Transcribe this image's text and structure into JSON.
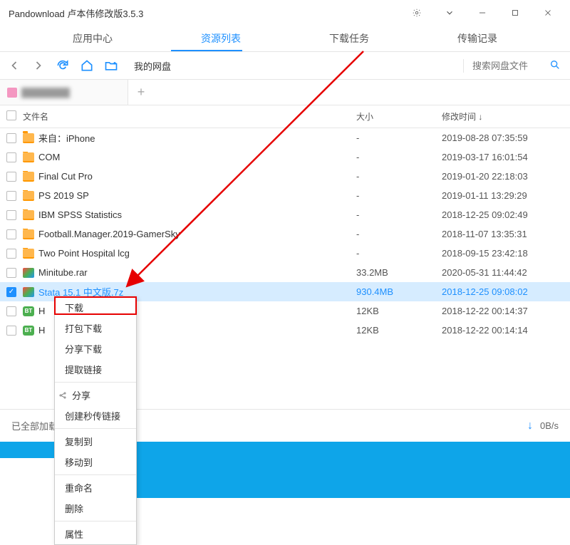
{
  "title": "Pandownload 卢本伟修改版3.5.3",
  "tabs": [
    "应用中心",
    "资源列表",
    "下载任务",
    "传输记录"
  ],
  "activeTab": 1,
  "path": "我的网盘",
  "searchPlaceholder": "搜索网盘文件",
  "columns": {
    "name": "文件名",
    "size": "大小",
    "time": "修改时间 ↓"
  },
  "files": [
    {
      "type": "folder",
      "name": "来自：iPhone",
      "size": "-",
      "time": "2019-08-28 07:35:59",
      "checked": false
    },
    {
      "type": "folder",
      "name": "COM",
      "size": "-",
      "time": "2019-03-17 16:01:54",
      "checked": false
    },
    {
      "type": "folder",
      "name": "Final Cut Pro",
      "size": "-",
      "time": "2019-01-20 22:18:03",
      "checked": false
    },
    {
      "type": "folder",
      "name": "PS 2019 SP",
      "size": "-",
      "time": "2019-01-11 13:29:29",
      "checked": false
    },
    {
      "type": "folder",
      "name": "IBM SPSS Statistics",
      "size": "-",
      "time": "2018-12-25 09:02:49",
      "checked": false
    },
    {
      "type": "folder",
      "name": "Football.Manager.2019-GamerSky",
      "size": "-",
      "time": "2018-11-07 13:35:31",
      "checked": false
    },
    {
      "type": "folder",
      "name": "Two Point Hospital lcg",
      "size": "-",
      "time": "2018-09-15 23:42:18",
      "checked": false
    },
    {
      "type": "archive",
      "name": "Minitube.rar",
      "size": "33.2MB",
      "time": "2020-05-31 11:44:42",
      "checked": false
    },
    {
      "type": "archive",
      "name": "Stata 15.1 中文版.7z",
      "size": "930.4MB",
      "time": "2018-12-25 09:08:02",
      "checked": true,
      "selected": true
    },
    {
      "type": "bt",
      "name": "H",
      "size": "12KB",
      "time": "2018-12-22 00:14:37",
      "checked": false
    },
    {
      "type": "bt",
      "name": "H",
      "size": "12KB",
      "time": "2018-12-22 00:14:14",
      "checked": false
    }
  ],
  "contextMenu": {
    "groups": [
      [
        "下载",
        "打包下载",
        "分享下载",
        "提取链接"
      ],
      [
        "分享",
        "创建秒传链接"
      ],
      [
        "复制到",
        "移动到"
      ],
      [
        "重命名",
        "删除"
      ],
      [
        "属性"
      ]
    ],
    "highlightIndex": 0
  },
  "status": {
    "left": "已全部加载",
    "speed": "0B/s"
  }
}
